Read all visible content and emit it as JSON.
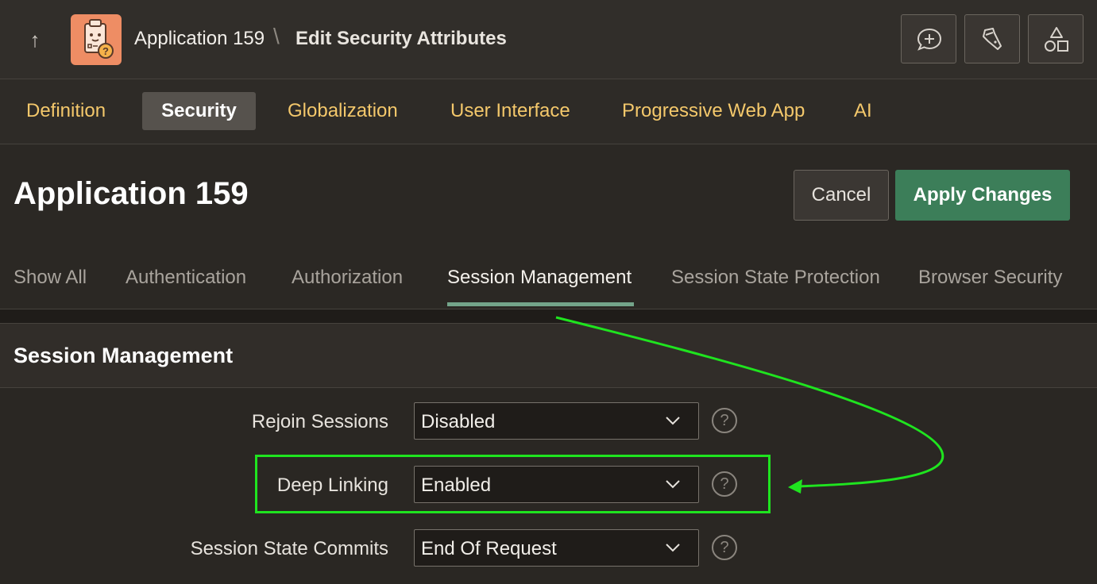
{
  "header": {
    "breadcrumb_app": "Application 159",
    "breadcrumb_separator": "\\",
    "breadcrumb_page": "Edit Security Attributes",
    "up_icon": "arrow-up-icon",
    "app_icon": "application-icon",
    "tool_icons": [
      "comment-add-icon",
      "flashlight-icon",
      "shapes-icon"
    ]
  },
  "attribute_tabs": [
    {
      "label": "Definition"
    },
    {
      "label": "Security"
    },
    {
      "label": "Globalization"
    },
    {
      "label": "User Interface"
    },
    {
      "label": "Progressive Web App"
    },
    {
      "label": "AI"
    }
  ],
  "page": {
    "title": "Application 159",
    "cancel_label": "Cancel",
    "apply_label": "Apply Changes"
  },
  "section_tabs": [
    {
      "label": "Show All"
    },
    {
      "label": "Authentication"
    },
    {
      "label": "Authorization"
    },
    {
      "label": "Session Management"
    },
    {
      "label": "Session State Protection"
    },
    {
      "label": "Browser Security"
    }
  ],
  "region": {
    "title": "Session Management",
    "fields": [
      {
        "label": "Rejoin Sessions",
        "value": "Disabled",
        "help": "?"
      },
      {
        "label": "Deep Linking",
        "value": "Enabled",
        "help": "?"
      },
      {
        "label": "Session State Commits",
        "value": "End Of Request",
        "help": "?"
      }
    ]
  },
  "colors": {
    "accent_tab": "#f4c86b",
    "primary_button": "#3c7e59",
    "annotation": "#1fe41f",
    "active_underline": "#74a48a"
  }
}
